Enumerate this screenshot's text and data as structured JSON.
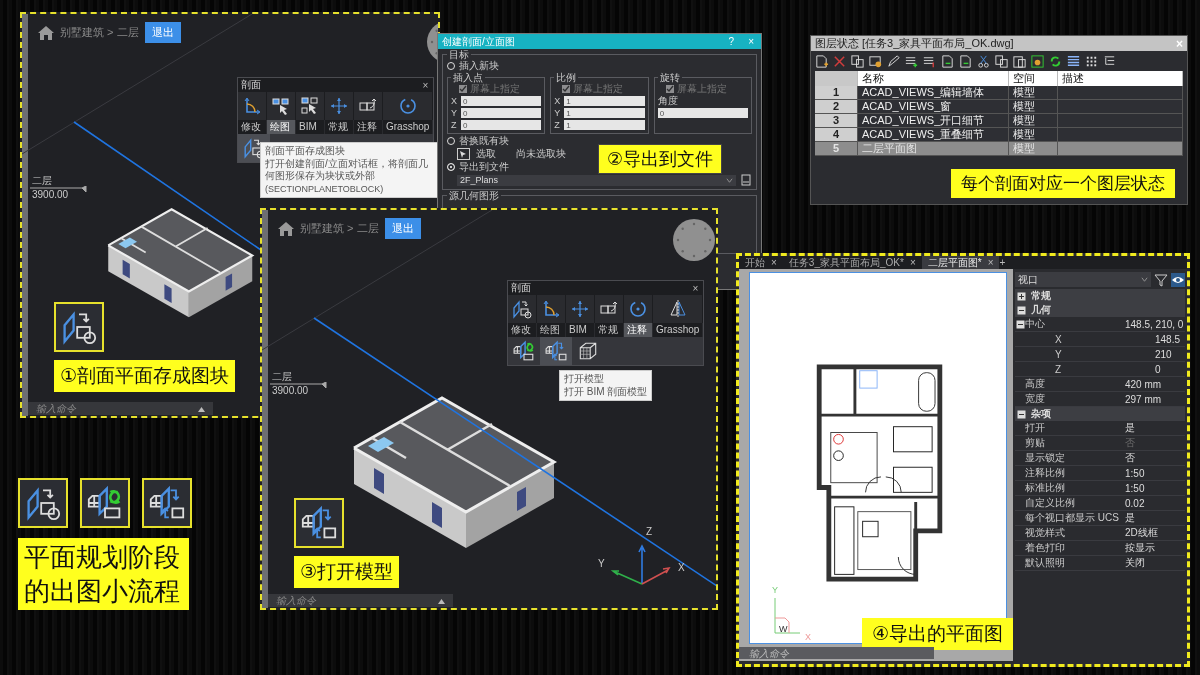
{
  "viewports": [
    {
      "breadcrumb": "别墅建筑 > 二层",
      "exit_button": "退出",
      "level_name": "二层",
      "level_elevation": "3900.00",
      "section_toolbar": {
        "title": "剖面",
        "close": "×",
        "tools": [
          {
            "kind": "corner-arrows"
          },
          {
            "kind": "pick-cursor"
          },
          {
            "kind": "pick-multiple"
          },
          {
            "kind": "move"
          },
          {
            "kind": "box-arrow"
          },
          {
            "kind": "circle-dot"
          }
        ],
        "tabs": [
          {
            "label": "修改",
            "selected": false
          },
          {
            "label": "绘图",
            "selected": true
          },
          {
            "label": "BIM",
            "selected": false
          },
          {
            "label": "常规",
            "selected": false
          },
          {
            "label": "注释",
            "selected": false
          },
          {
            "label": "Grasshop",
            "selected": false
          }
        ],
        "bottom_tools": [
          {
            "kind": "plane-to-block",
            "hovered": true
          }
        ]
      },
      "tooltip": {
        "title": "剖面平面存成图块",
        "description": "打开创建剖面/立面对话框，将剖面几何图形保存为块状或外部",
        "command": "(SECTIONPLANETOBLOCK)"
      },
      "command_line": {
        "placeholder": "输入命令"
      },
      "step_icon": {
        "kind": "plane-to-block"
      },
      "step_label": "①剖面平面存成图块"
    },
    {
      "breadcrumb": "别墅建筑 > 二层",
      "exit_button": "退出",
      "level_name": "二层",
      "level_elevation": "3900.00",
      "section_toolbar": {
        "title": "剖面",
        "close": "×",
        "tools": [
          {
            "kind": "plane-to-block"
          },
          {
            "kind": "corner-arrows"
          },
          {
            "kind": "move"
          },
          {
            "kind": "box-arrow"
          },
          {
            "kind": "circle-dot"
          },
          {
            "kind": "mirror"
          }
        ],
        "tabs": [
          {
            "label": "修改",
            "selected": false
          },
          {
            "label": "绘图",
            "selected": false
          },
          {
            "label": "BIM",
            "selected": false
          },
          {
            "label": "常规",
            "selected": false
          },
          {
            "label": "注释",
            "selected": true
          },
          {
            "label": "Grasshop",
            "selected": false
          }
        ],
        "bottom_tools": [
          {
            "kind": "model-sync",
            "hovered": false
          },
          {
            "kind": "model-open",
            "hovered": true
          },
          {
            "kind": "block-cube",
            "hovered": false
          }
        ]
      },
      "tooltip": {
        "title": "打开模型",
        "description": "打开 BIM 剖面模型"
      },
      "command_line": {
        "placeholder": "输入命令"
      },
      "step_icon": {
        "kind": "model-open"
      },
      "step_label": "③打开模型",
      "axis_labels": {
        "x": "X",
        "y": "Y",
        "z": "Z"
      }
    }
  ],
  "export_dialog": {
    "title": "创建剖面/立面图",
    "help_button": "?",
    "close_button": "×",
    "target_group": "目标",
    "options": [
      {
        "label": "插入新块",
        "selected": false
      },
      {
        "label": "替换既有块",
        "selected": false
      },
      {
        "label": "导出到文件",
        "selected": true
      }
    ],
    "insert_groups": [
      {
        "kind": "xyz",
        "title": "插入点",
        "specify": {
          "label": "屏幕上指定",
          "checked": true,
          "disabled": true
        },
        "fields": [
          {
            "axis": "X",
            "value": "0"
          },
          {
            "axis": "Y",
            "value": "0"
          },
          {
            "axis": "Z",
            "value": "0"
          }
        ]
      },
      {
        "kind": "xyz",
        "title": "比例",
        "specify": {
          "label": "屏幕上指定",
          "checked": true,
          "disabled": true
        },
        "fields": [
          {
            "axis": "X",
            "value": "1"
          },
          {
            "axis": "Y",
            "value": "1"
          },
          {
            "axis": "Z",
            "value": "1"
          }
        ]
      },
      {
        "kind": "angle",
        "title": "旋转",
        "specify": {
          "label": "屏幕上指定",
          "checked": true,
          "disabled": true
        },
        "angle_label": "角度",
        "angle": "0"
      }
    ],
    "pick_label": "选取",
    "pick_status": "尚未选取块",
    "file_path": "2F_Plans",
    "source_group": "源几何图形",
    "step_label": "②导出到文件"
  },
  "layer_states": {
    "title": "图层状态 [任务3_家具平面布局_OK.dwg]",
    "close_button": "×",
    "columns": [
      "名称",
      "空间",
      "描述"
    ],
    "rows": [
      {
        "index": "1",
        "name": "ACAD_VIEWS_编辑墙体",
        "space": "模型",
        "selected": false
      },
      {
        "index": "2",
        "name": "ACAD_VIEWS_窗",
        "space": "模型",
        "selected": false
      },
      {
        "index": "3",
        "name": "ACAD_VIEWS_开口细节",
        "space": "模型",
        "selected": false
      },
      {
        "index": "4",
        "name": "ACAD_VIEWS_重叠细节",
        "space": "模型",
        "selected": false
      },
      {
        "index": "5",
        "name": "二层平面图",
        "space": "模型",
        "selected": true
      }
    ],
    "caption": "每个剖面对应一个图层状态"
  },
  "layout": {
    "tabs": [
      {
        "label": "开始",
        "close": "×",
        "selected": false
      },
      {
        "label": "任务3_家具平面布局_OK*",
        "close": "×",
        "selected": false
      },
      {
        "label": "二层平面图*",
        "close": "×",
        "selected": true
      }
    ],
    "new_tab": "+",
    "ucs_labels": {
      "y": "Y",
      "origin": "W",
      "x": "X"
    },
    "command_line": {
      "placeholder": "输入命令"
    },
    "step_label": "④导出的平面图",
    "properties": {
      "selector": "视口",
      "sections": [
        {
          "name": "常规",
          "expanded": false
        },
        {
          "name": "几何",
          "expanded": true,
          "rows": [
            {
              "name": "中心",
              "value": "148.5, 210, 0",
              "disabled": false,
              "children": [
                {
                  "name": "X",
                  "value": "148.5",
                  "disabled": false
                },
                {
                  "name": "Y",
                  "value": "210",
                  "disabled": false
                },
                {
                  "name": "Z",
                  "value": "0",
                  "disabled": false
                }
              ]
            },
            {
              "name": "高度",
              "value": "420 mm",
              "disabled": false
            },
            {
              "name": "宽度",
              "value": "297 mm",
              "disabled": false
            }
          ]
        },
        {
          "name": "杂项",
          "expanded": true,
          "rows": [
            {
              "name": "打开",
              "value": "是",
              "disabled": false
            },
            {
              "name": "剪贴",
              "value": "否",
              "disabled": true
            },
            {
              "name": "显示锁定",
              "value": "否",
              "disabled": false
            },
            {
              "name": "注释比例",
              "value": "1:50",
              "disabled": false
            },
            {
              "name": "标准比例",
              "value": "1:50",
              "disabled": false
            },
            {
              "name": "自定义比例",
              "value": "0.02",
              "disabled": false
            },
            {
              "name": "每个视口都显示 UCS",
              "value": "是",
              "disabled": false
            },
            {
              "name": "视觉样式",
              "value": "2D线框",
              "disabled": false
            },
            {
              "name": "着色打印",
              "value": "按显示",
              "disabled": false
            },
            {
              "name": "默认照明",
              "value": "关闭",
              "disabled": false
            }
          ]
        }
      ]
    }
  },
  "summary": {
    "icons": [
      {
        "kind": "plane-to-block"
      },
      {
        "kind": "model-sync"
      },
      {
        "kind": "model-open"
      }
    ],
    "label": "平面规划阶段的出图小流程"
  }
}
